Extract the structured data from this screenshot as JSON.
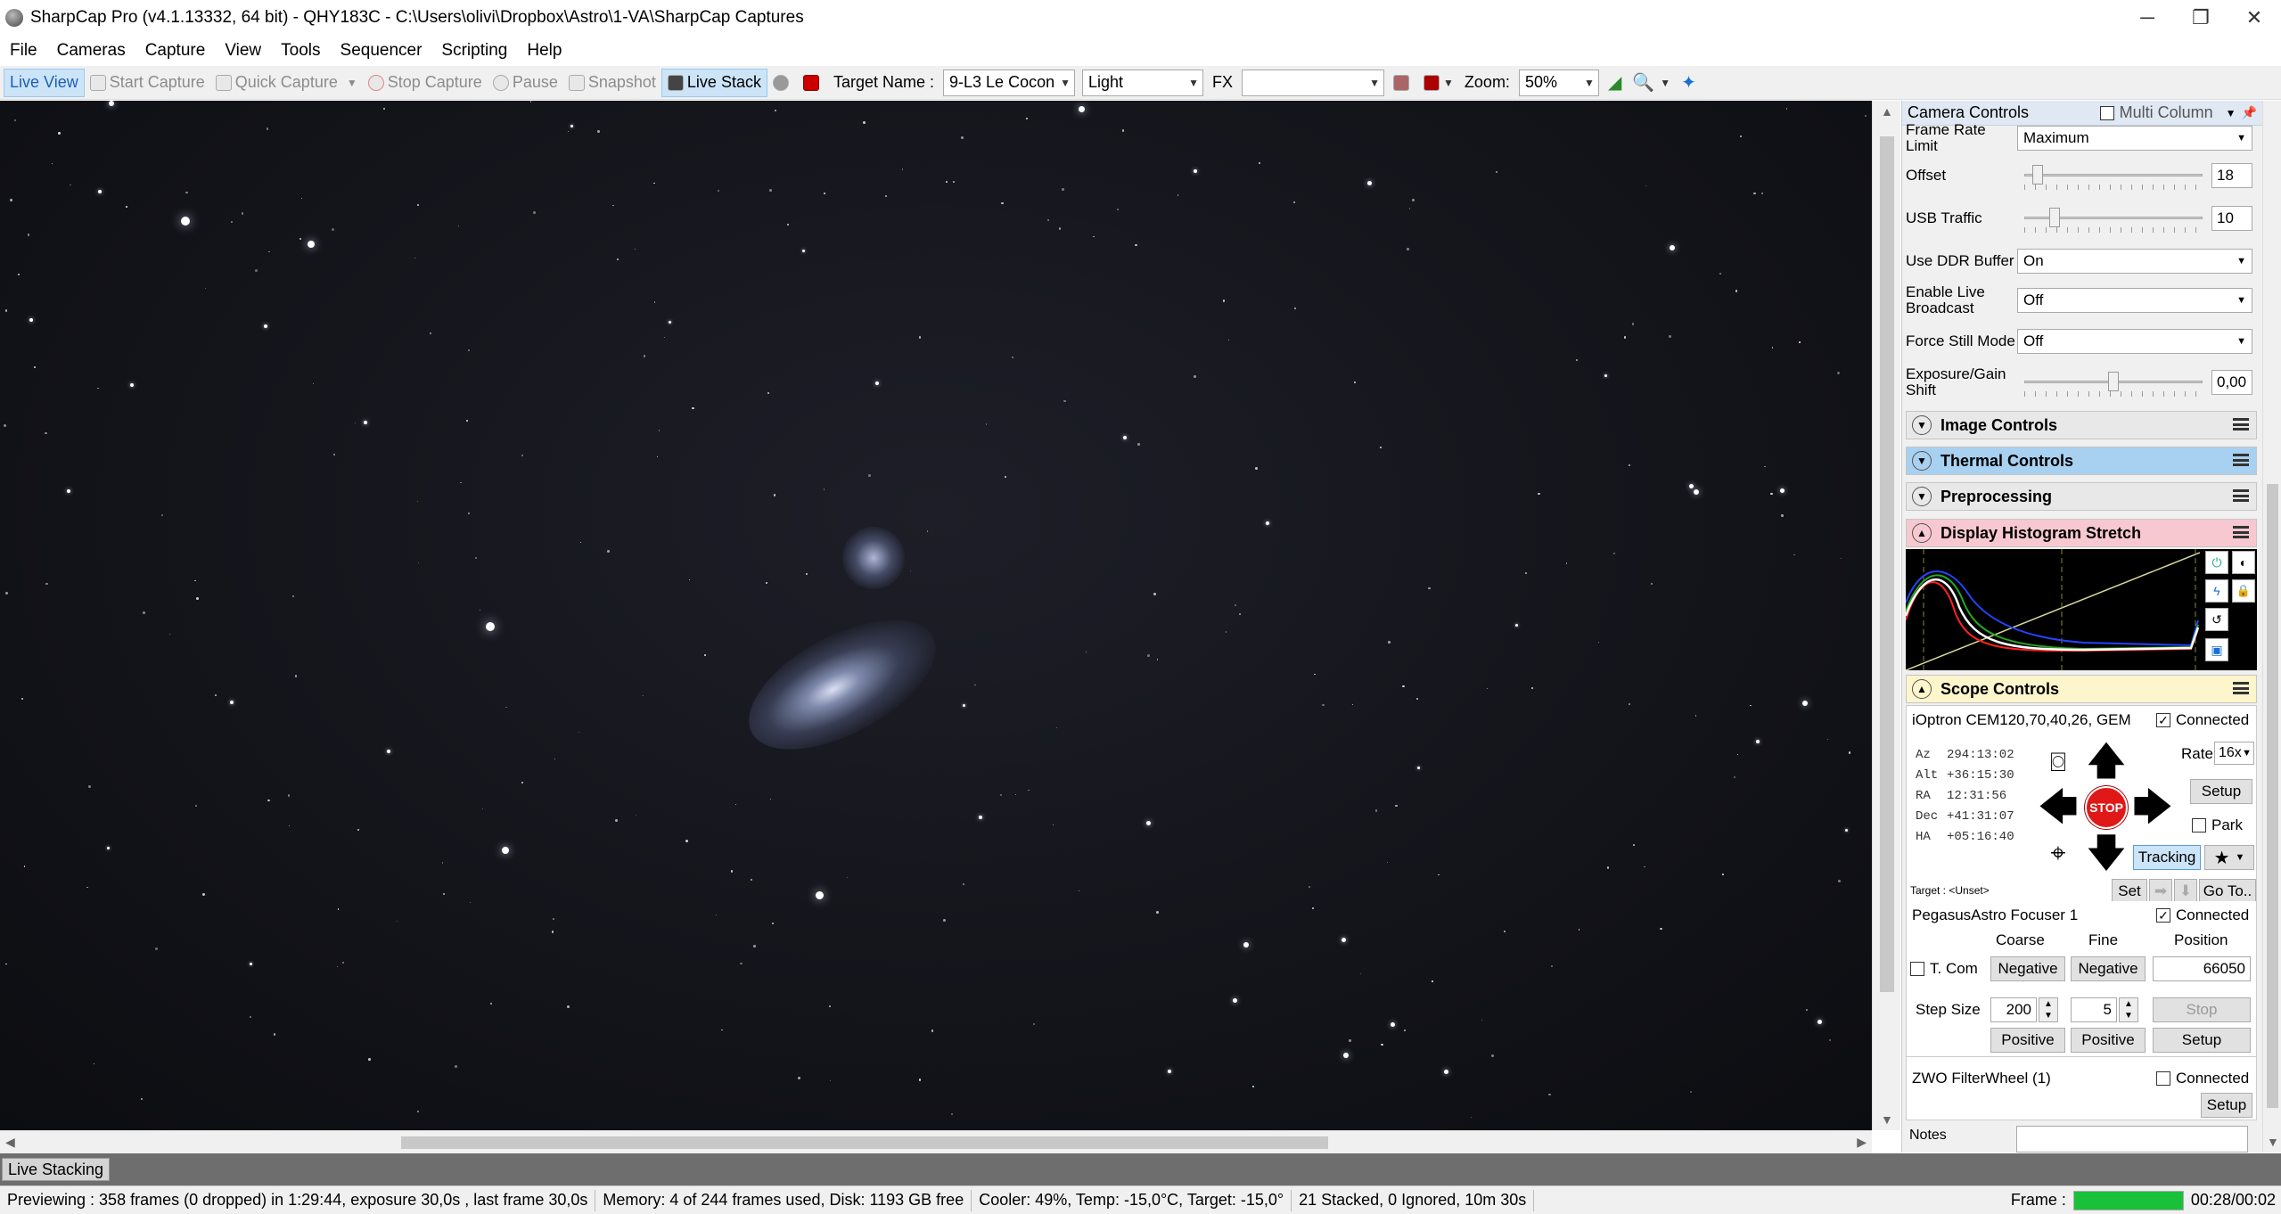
{
  "window": {
    "title": "SharpCap Pro (v4.1.13332, 64 bit) - QHY183C - C:\\Users\\olivi\\Dropbox\\Astro\\1-VA\\SharpCap Captures"
  },
  "menu": [
    "File",
    "Cameras",
    "Capture",
    "View",
    "Tools",
    "Sequencer",
    "Scripting",
    "Help"
  ],
  "toolbar": {
    "live_view": "Live View",
    "start_capture": "Start Capture",
    "quick_capture": "Quick Capture",
    "stop_capture": "Stop Capture",
    "pause": "Pause",
    "snapshot": "Snapshot",
    "live_stack": "Live Stack",
    "target_label": "Target Name :",
    "target_value": "9-L3 Le Cocon",
    "frame_type": "Light",
    "fx_label": "FX",
    "fx_value": "",
    "zoom_label": "Zoom:",
    "zoom_value": "50%"
  },
  "camera_controls": {
    "title": "Camera Controls",
    "multi_column": "Multi Column",
    "frame_rate_label": "Frame Rate Limit",
    "frame_rate_value": "Maximum",
    "offset_label": "Offset",
    "offset_value": "18",
    "offset_level": 0.05,
    "usb_label": "USB Traffic",
    "usb_value": "10",
    "usb_level": 0.15,
    "ddr_label": "Use DDR Buffer",
    "ddr_value": "On",
    "broadcast_label": "Enable Live Broadcast",
    "broadcast_value": "Off",
    "still_label": "Force Still Mode",
    "still_value": "Off",
    "shift_label": "Exposure/Gain Shift",
    "shift_value": "0,00",
    "shift_level": 0.5
  },
  "sections": {
    "image": "Image Controls",
    "thermal": "Thermal Controls",
    "preproc": "Preprocessing",
    "histogram": "Display Histogram Stretch",
    "scope": "Scope Controls"
  },
  "scope": {
    "mount": "iOptron CEM120,70,40,26, GEM",
    "connected": "Connected",
    "rate_label": "Rate:",
    "rate_value": "16x",
    "setup": "Setup",
    "park": "Park",
    "tracking": "Tracking",
    "stop": "STOP",
    "set": "Set",
    "goto": "Go To..",
    "coords": [
      {
        "k": "Az",
        "v": "294:13:02"
      },
      {
        "k": "Alt",
        "v": "+36:15:30"
      },
      {
        "k": "RA",
        "v": "12:31:56"
      },
      {
        "k": "Dec",
        "v": "+41:31:07"
      },
      {
        "k": "HA",
        "v": "+05:16:40"
      }
    ],
    "target": "Target : <Unset>"
  },
  "focuser": {
    "name": "PegasusAstro Focuser 1",
    "connected": "Connected",
    "coarse": "Coarse",
    "fine": "Fine",
    "position": "Position",
    "tcomp": "T. Com",
    "negative": "Negative",
    "positive": "Positive",
    "position_value": "66050",
    "step_size": "Step Size",
    "coarse_step": "200",
    "fine_step": "5",
    "stop": "Stop",
    "setup": "Setup"
  },
  "filterwheel": {
    "name": "ZWO FilterWheel (1)",
    "connected": "Connected",
    "setup": "Setup"
  },
  "notes": {
    "label": "Notes"
  },
  "bottom_tab": "Live Stacking",
  "status": {
    "preview": "Previewing : 358 frames (0 dropped) in 1:29:44, exposure 30,0s , last frame 30,0s",
    "memory": "Memory: 4 of 244 frames used, Disk: 1193 GB free",
    "cooler": "Cooler: 49%, Temp: -15,0°C, Target: -15,0°",
    "stacked": "21 Stacked, 0 Ignored, 10m 30s",
    "frame_label": "Frame :",
    "time": "00:28/00:02"
  },
  "colors": {
    "accent": "#1a5fb4",
    "thermal_header": "#a8d0f0",
    "histogram_header": "#f7c8d0",
    "scope_header": "#fdf5cc",
    "frame_progress": "#19c13a"
  }
}
